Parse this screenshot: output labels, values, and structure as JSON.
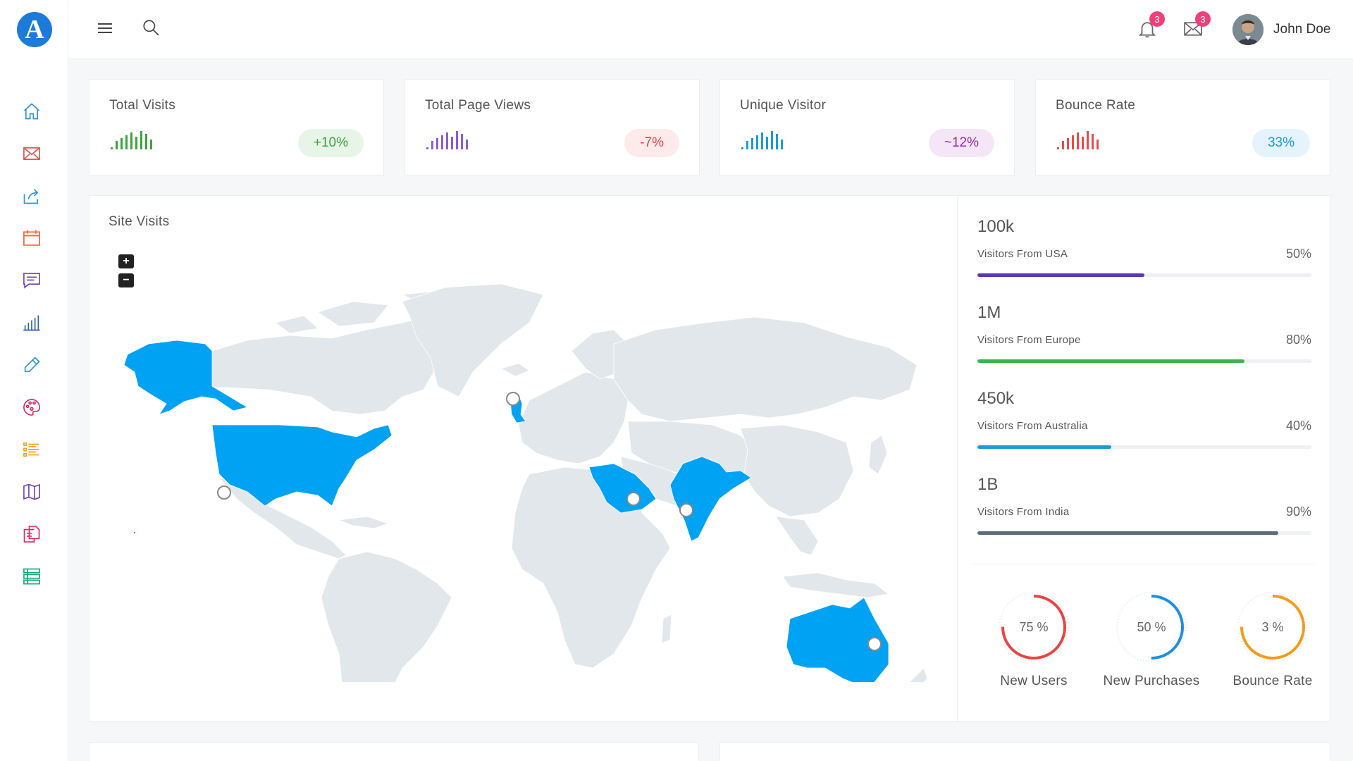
{
  "app": {
    "logo_letter": "A",
    "brand_color": "#1c7bd8"
  },
  "header": {
    "menu_icon": "hamburger-icon",
    "search_icon": "search-icon",
    "notifications": {
      "icon": "bell-icon",
      "count": "3"
    },
    "messages": {
      "icon": "envelope-icon",
      "count": "3"
    },
    "user_name": "John Doe"
  },
  "sidebar": {
    "items": [
      {
        "icon": "home-icon",
        "color": "#2a93d5"
      },
      {
        "icon": "mail-icon",
        "color": "#d9534f"
      },
      {
        "icon": "share-icon",
        "color": "#2a93d5"
      },
      {
        "icon": "calendar-icon",
        "color": "#e8643c"
      },
      {
        "icon": "chat-icon",
        "color": "#6f42c1"
      },
      {
        "icon": "bar-chart-icon",
        "color": "#2a5fb0"
      },
      {
        "icon": "pencil-icon",
        "color": "#2a93d5"
      },
      {
        "icon": "palette-icon",
        "color": "#e0245e"
      },
      {
        "icon": "list-icon",
        "color": "#f0a020"
      },
      {
        "icon": "map-icon",
        "color": "#6f42c1"
      },
      {
        "icon": "documents-icon",
        "color": "#e0245e"
      },
      {
        "icon": "table-list-icon",
        "color": "#1aa37a"
      }
    ]
  },
  "stats": [
    {
      "title": "Total Visits",
      "badge": "+10%",
      "color": "#3aa53c",
      "badge_bg": "#e7f5e8"
    },
    {
      "title": "Total Page Views",
      "badge": "-7%",
      "color": "#8e5cd9",
      "badge_bg": "#fdeaea",
      "badge_color": "#e04545"
    },
    {
      "title": "Unique Visitor",
      "badge": "~12%",
      "color": "#1d9ad6",
      "badge_bg": "#f5e6f7",
      "badge_color": "#8e2aa8"
    },
    {
      "title": "Bounce Rate",
      "badge": "33%",
      "color": "#e94b4b",
      "badge_bg": "#e5f3fc",
      "badge_color": "#1d9ad6"
    }
  ],
  "map": {
    "title": "Site Visits",
    "zoom_in": "+",
    "zoom_out": "−",
    "land_color": "#e2e7eb",
    "highlight_color": "#00a2f3",
    "highlighted": [
      "USA",
      "Alaska",
      "United Kingdom",
      "Saudi Arabia",
      "India",
      "Australia"
    ]
  },
  "visitors": [
    {
      "value": "100k",
      "label": "Visitors From USA",
      "pct": "50%",
      "fraction": 0.5,
      "color": "#5b35b8"
    },
    {
      "value": "1M",
      "label": "Visitors From Europe",
      "pct": "80%",
      "fraction": 0.8,
      "color": "#3bb54a"
    },
    {
      "value": "450k",
      "label": "Visitors From Australia",
      "pct": "40%",
      "fraction": 0.4,
      "color": "#1d9ad6"
    },
    {
      "value": "1B",
      "label": "Visitors From India",
      "pct": "90%",
      "fraction": 0.9,
      "color": "#5b6b7b"
    }
  ],
  "donuts": [
    {
      "text": "75 %",
      "label": "New Users",
      "fraction": 0.75,
      "color": "#e84545"
    },
    {
      "text": "50 %",
      "label": "New Purchases",
      "fraction": 0.5,
      "color": "#1d8fe0"
    },
    {
      "text": "3 %",
      "label": "Bounce Rate",
      "fraction": 0.75,
      "color": "#f39c1a"
    }
  ]
}
